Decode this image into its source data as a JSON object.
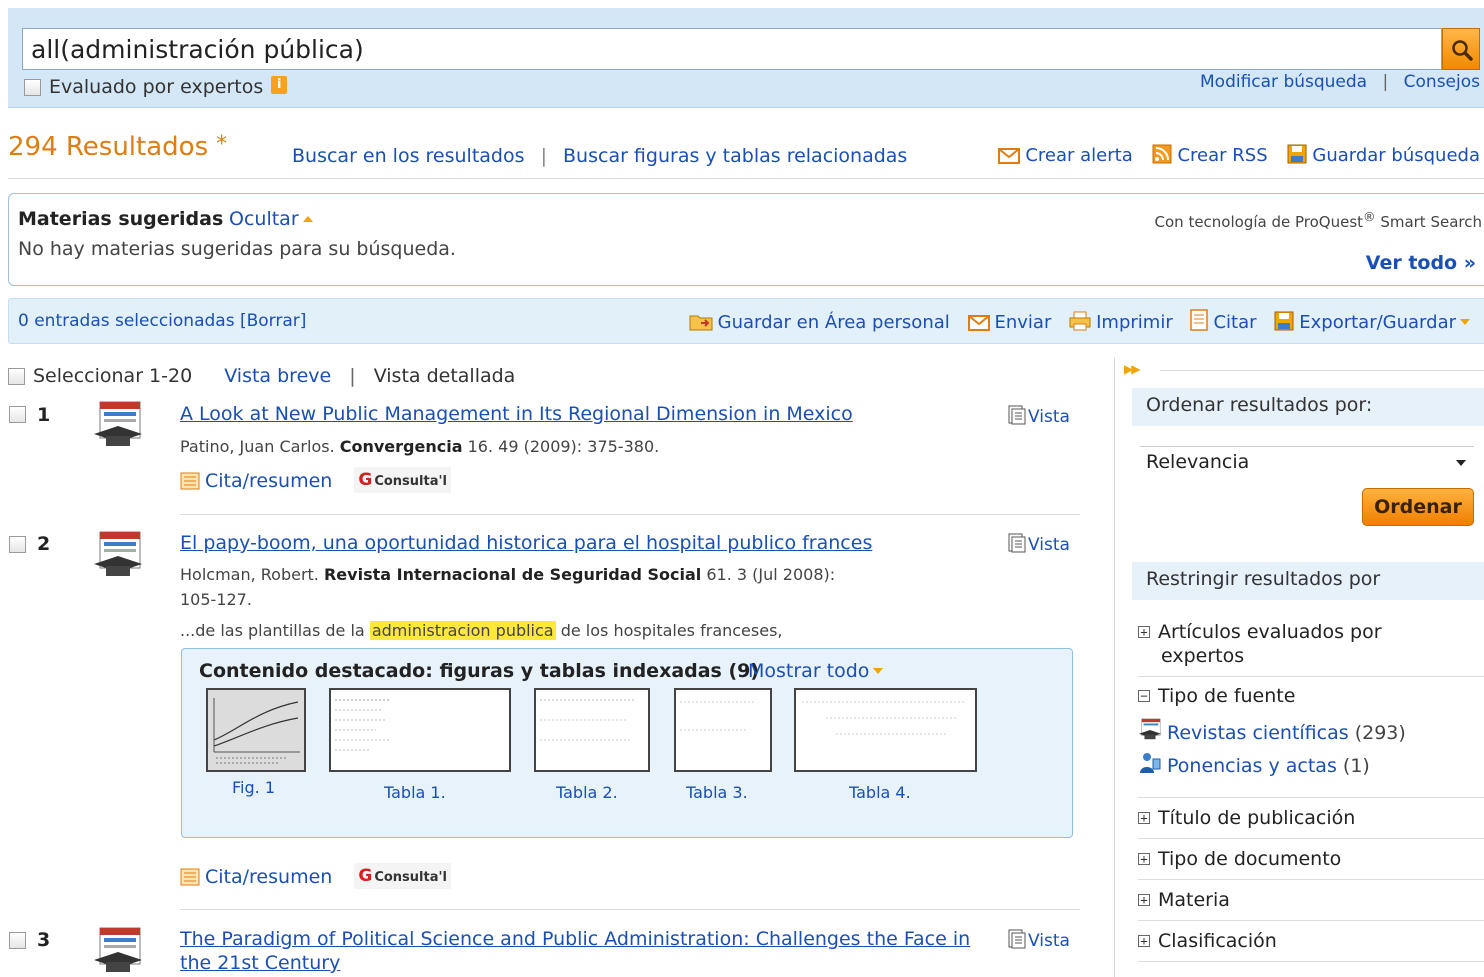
{
  "search": {
    "query": "all(administración pública)",
    "peer_reviewed_label": "Evaluado por expertos",
    "info_icon": "i",
    "modify_link": "Modificar búsqueda",
    "separator": "|",
    "tips_link": "Consejos"
  },
  "results_header": {
    "count_text": "294 Resultados",
    "star": "*",
    "search_within": "Buscar en los resultados",
    "separator": "|",
    "search_figures": "Buscar figuras y tablas relacionadas",
    "create_alert": "Crear alerta",
    "create_rss": "Crear RSS",
    "save_search": "Guardar búsqueda"
  },
  "subjects": {
    "title": "Materias sugeridas",
    "hide": "Ocultar",
    "none": "No hay materias sugeridas para su búsqueda.",
    "powered_prefix": "Con tecnología de ProQuest",
    "powered_reg": "®",
    "powered_suffix": "Smart Search",
    "view_all": "Ver todo »"
  },
  "selection_bar": {
    "selected": "0 entradas seleccionadas [Borrar]",
    "save_area": "Guardar en Área personal",
    "send": "Enviar",
    "print": "Imprimir",
    "cite": "Citar",
    "export": "Exportar/Guardar"
  },
  "list_controls": {
    "select_range": "Seleccionar 1-20",
    "brief_view": "Vista breve",
    "separator": "|",
    "detailed_view": "Vista detallada"
  },
  "results": [
    {
      "num": "1",
      "title": "A Look at New Public Management in Its Regional Dimension in Mexico",
      "author": "Patino, Juan Carlos.",
      "source": "Convergencia",
      "details": "16. 49 (2009): 375-380.",
      "vista": "Vista",
      "cite_abstract": "Cita/resumen",
      "consulta": "Consulta'l"
    },
    {
      "num": "2",
      "title": "El papy-boom, una oportunidad historica para el hospital publico frances",
      "author": "Holcman, Robert.",
      "source": "Revista Internacional de Seguridad Social",
      "details": "61. 3 (Jul 2008):",
      "details2": "105-127.",
      "snippet_pre": "...de las plantillas de la",
      "snippet_hl": "administracion publica",
      "snippet_post": "de los hospitales franceses,",
      "vista": "Vista",
      "cite_abstract": "Cita/resumen",
      "consulta": "Consulta'l",
      "featured": {
        "title": "Contenido destacado: figuras y tablas indexadas (9)",
        "show_all": "Mostrar todo",
        "items": [
          "Fig. 1",
          "Tabla 1.",
          "Tabla 2.",
          "Tabla 3.",
          "Tabla 4."
        ]
      }
    },
    {
      "num": "3",
      "title_line1": "The Paradigm of Political Science and Public Administration: Challenges the Face in",
      "title_line2": "the 21st Century",
      "vista": "Vista"
    }
  ],
  "sidebar": {
    "sort_heading": "Ordenar resultados por:",
    "sort_value": "Relevancia",
    "sort_button": "Ordenar",
    "refine_heading": "Restringir resultados por",
    "facets": {
      "peer_reviewed_1": "Artículos evaluados por",
      "peer_reviewed_2": "expertos",
      "source_type": "Tipo de fuente",
      "journals": "Revistas científicas",
      "journals_count": "(293)",
      "proceedings": "Ponencias y actas",
      "proceedings_count": "(1)",
      "pub_title": "Título de publicación",
      "doc_type": "Tipo de documento",
      "subject": "Materia",
      "classification": "Clasificación",
      "expand": "+",
      "collapse": "−"
    }
  },
  "colors": {
    "accent_orange": "#e07d10",
    "link_blue": "#1a4fb5",
    "band_blue": "#d3e7f7",
    "highlight_yellow": "#ffe83a"
  },
  "icons": [
    "search-icon",
    "info-icon",
    "mail-icon",
    "rss-icon",
    "save-icon",
    "folder-icon",
    "print-icon",
    "cite-icon",
    "export-icon",
    "journal-icon",
    "doc-icon",
    "conference-icon"
  ]
}
